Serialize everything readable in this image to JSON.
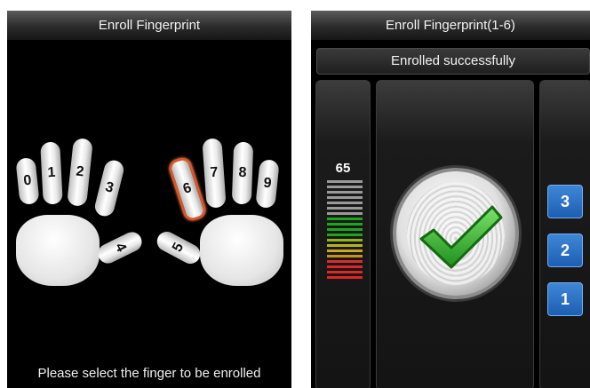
{
  "left_screen": {
    "title": "Enroll Fingerprint",
    "prompt": "Please select the finger to be enrolled",
    "fingers": [
      "0",
      "1",
      "2",
      "3",
      "4",
      "5",
      "6",
      "7",
      "8",
      "9"
    ],
    "selected_finger": "6",
    "colors": {
      "selected_outline": "#d9572a"
    }
  },
  "right_screen": {
    "title": "Enroll Fingerprint(1-6)",
    "status": "Enrolled successfully",
    "quality": {
      "value": "65"
    },
    "counts": [
      "3",
      "2",
      "1"
    ],
    "icons": {
      "fingerprint": "fingerprint-icon",
      "check": "check-icon"
    },
    "colors": {
      "accent_blue": "#2f73c8",
      "check_green": "#3bbf2e"
    }
  }
}
